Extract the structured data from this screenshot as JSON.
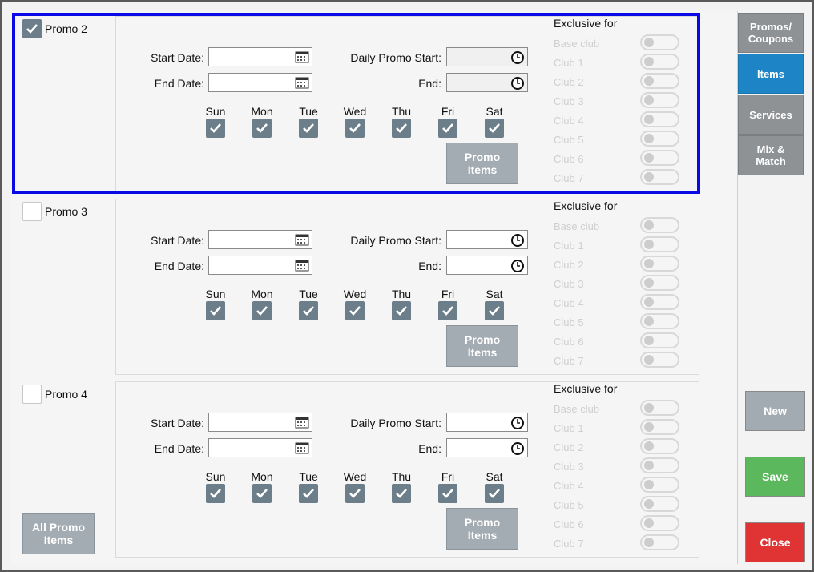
{
  "promos": [
    {
      "label": "Promo 2",
      "checked": true,
      "start_date_label": "Start Date:",
      "end_date_label": "End Date:",
      "start_date_value": "",
      "end_date_value": "",
      "daily_start_label": "Daily Promo Start:",
      "daily_end_label": "End:",
      "daily_start_value": "",
      "daily_end_value": "",
      "time_inputs_disabled": true,
      "days": [
        {
          "label": "Sun",
          "checked": true
        },
        {
          "label": "Mon",
          "checked": true
        },
        {
          "label": "Tue",
          "checked": true
        },
        {
          "label": "Wed",
          "checked": true
        },
        {
          "label": "Thu",
          "checked": true
        },
        {
          "label": "Fri",
          "checked": true
        },
        {
          "label": "Sat",
          "checked": true
        }
      ],
      "promo_items_label": [
        "Promo",
        "Items"
      ],
      "exclusive_title": "Exclusive for",
      "clubs": [
        "Base club",
        "Club 1",
        "Club 2",
        "Club 3",
        "Club 4",
        "Club 5",
        "Club 6",
        "Club 7"
      ]
    },
    {
      "label": "Promo 3",
      "checked": false,
      "start_date_label": "Start Date:",
      "end_date_label": "End Date:",
      "start_date_value": "",
      "end_date_value": "",
      "daily_start_label": "Daily Promo Start:",
      "daily_end_label": "End:",
      "daily_start_value": "",
      "daily_end_value": "",
      "time_inputs_disabled": false,
      "days": [
        {
          "label": "Sun",
          "checked": true
        },
        {
          "label": "Mon",
          "checked": true
        },
        {
          "label": "Tue",
          "checked": true
        },
        {
          "label": "Wed",
          "checked": true
        },
        {
          "label": "Thu",
          "checked": true
        },
        {
          "label": "Fri",
          "checked": true
        },
        {
          "label": "Sat",
          "checked": true
        }
      ],
      "promo_items_label": [
        "Promo",
        "Items"
      ],
      "exclusive_title": "Exclusive for",
      "clubs": [
        "Base club",
        "Club 1",
        "Club 2",
        "Club 3",
        "Club 4",
        "Club 5",
        "Club 6",
        "Club 7"
      ]
    },
    {
      "label": "Promo 4",
      "checked": false,
      "start_date_label": "Start Date:",
      "end_date_label": "End Date:",
      "start_date_value": "",
      "end_date_value": "",
      "daily_start_label": "Daily Promo Start:",
      "daily_end_label": "End:",
      "daily_start_value": "",
      "daily_end_value": "",
      "time_inputs_disabled": false,
      "days": [
        {
          "label": "Sun",
          "checked": true
        },
        {
          "label": "Mon",
          "checked": true
        },
        {
          "label": "Tue",
          "checked": true
        },
        {
          "label": "Wed",
          "checked": true
        },
        {
          "label": "Thu",
          "checked": true
        },
        {
          "label": "Fri",
          "checked": true
        },
        {
          "label": "Sat",
          "checked": true
        }
      ],
      "promo_items_label": [
        "Promo",
        "Items"
      ],
      "exclusive_title": "Exclusive for",
      "clubs": [
        "Base club",
        "Club 1",
        "Club 2",
        "Club 3",
        "Club 4",
        "Club 5",
        "Club 6",
        "Club 7"
      ]
    }
  ],
  "all_promo_items_label": [
    "All Promo",
    "Items"
  ],
  "side_tabs": [
    {
      "label": [
        "Promos/",
        "Coupons"
      ],
      "active": false
    },
    {
      "label": [
        "Items"
      ],
      "active": true
    },
    {
      "label": [
        "Services"
      ],
      "active": false
    },
    {
      "label": [
        "Mix &",
        "Match"
      ],
      "active": false
    }
  ],
  "actions": {
    "new_label": "New",
    "save_label": "Save",
    "close_label": "Close"
  },
  "colors": {
    "active_tab": "#1d84c6",
    "save": "#5cb85c",
    "close": "#e03434",
    "new": "#a3abb2",
    "highlight": "#0a0ae6",
    "check_fill": "#6d7e8b"
  },
  "icons": {
    "date_picker": "calendar-icon",
    "time_picker": "clock-icon",
    "checkbox": "checkmark-icon"
  }
}
